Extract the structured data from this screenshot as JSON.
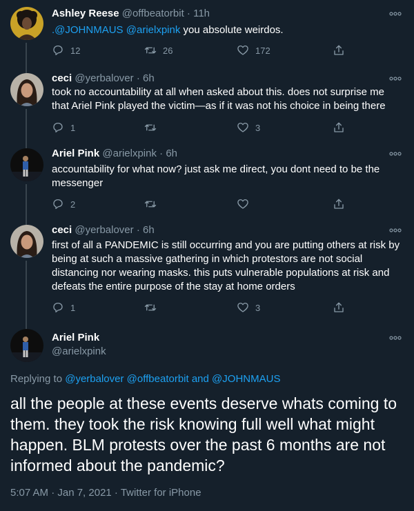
{
  "tweets": [
    {
      "name": "Ashley Reese",
      "handle": "@offbeatorbit",
      "dot": "·",
      "time": "11h",
      "mention1": ".@JOHNMAUS",
      "mention2": "@arielxpink",
      "text": " you absolute weirdos.",
      "replies": "12",
      "retweets": "26",
      "likes": "172"
    },
    {
      "name": "ceci",
      "handle": "@yerbalover",
      "dot": "·",
      "time": "6h",
      "text": "took no accountability at all when asked about this. does not surprise me that Ariel Pink played the victim—as if it was not his choice in being there",
      "replies": "1",
      "retweets": "",
      "likes": "3"
    },
    {
      "name": "Ariel Pink",
      "handle": "@arielxpink",
      "dot": "·",
      "time": "6h",
      "text": "accountability for what now? just ask me direct, you dont need to be the messenger",
      "replies": "2",
      "retweets": "",
      "likes": ""
    },
    {
      "name": "ceci",
      "handle": "@yerbalover",
      "dot": "·",
      "time": "6h",
      "text": "first of all a PANDEMIC is still occurring and you are putting others at risk by being at such a massive gathering in which protestors are not social distancing nor wearing masks. this puts vulnerable populations at risk and defeats the entire purpose of the stay at home orders",
      "replies": "1",
      "retweets": "",
      "likes": "3"
    }
  ],
  "main_tweet": {
    "name": "Ariel Pink",
    "handle": "@arielxpink",
    "replying_prefix": "Replying to ",
    "replying_mention1": "@yerbalover",
    "replying_mention2": "@offbeatorbit",
    "replying_and": " and ",
    "replying_mention3": "@JOHNMAUS",
    "text": "all the people at these events deserve whats coming to them. they took the risk knowing full well what might happen. BLM protests over the past 6 months are not informed about the pandemic?",
    "meta": "5:07 AM · Jan 7, 2021 · Twitter for iPhone"
  },
  "colors": {
    "background": "#15202b",
    "accent": "#1da1f2",
    "muted": "#8899a6",
    "divider": "#38444d"
  },
  "icons": [
    "reply-icon",
    "retweet-icon",
    "like-icon",
    "share-icon",
    "more-icon"
  ]
}
